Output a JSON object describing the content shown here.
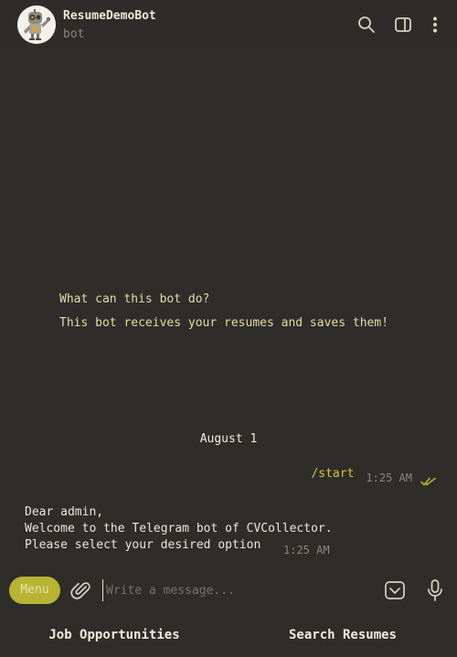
{
  "header": {
    "title": "ResumeDemoBot",
    "subtitle": "bot",
    "icons": [
      "search-icon",
      "sidebar-panel-icon",
      "more-vertical-icon"
    ]
  },
  "intro": {
    "heading": "What can this bot do?",
    "text": "This bot receives your resumes and saves them!"
  },
  "date_separator": "August 1",
  "messages": [
    {
      "direction": "outgoing",
      "text": "/start",
      "time": "1:25 AM",
      "status": "read"
    },
    {
      "direction": "incoming",
      "lines": [
        "Dear admin,",
        "Welcome to the Telegram bot of CVCollector.",
        "Please select your desired option"
      ],
      "time": "1:25 AM"
    }
  ],
  "composer": {
    "menu_label": "Menu",
    "placeholder": "Write a message...",
    "value": ""
  },
  "keyboard": {
    "buttons": [
      "Job Opportunities",
      "Search Resumes"
    ]
  },
  "colors": {
    "background": "#2e2d2a",
    "accent": "#b8b433",
    "outgoing_text": "#d4c53b",
    "intro_text": "#e5dca8",
    "muted": "#8a877c"
  }
}
